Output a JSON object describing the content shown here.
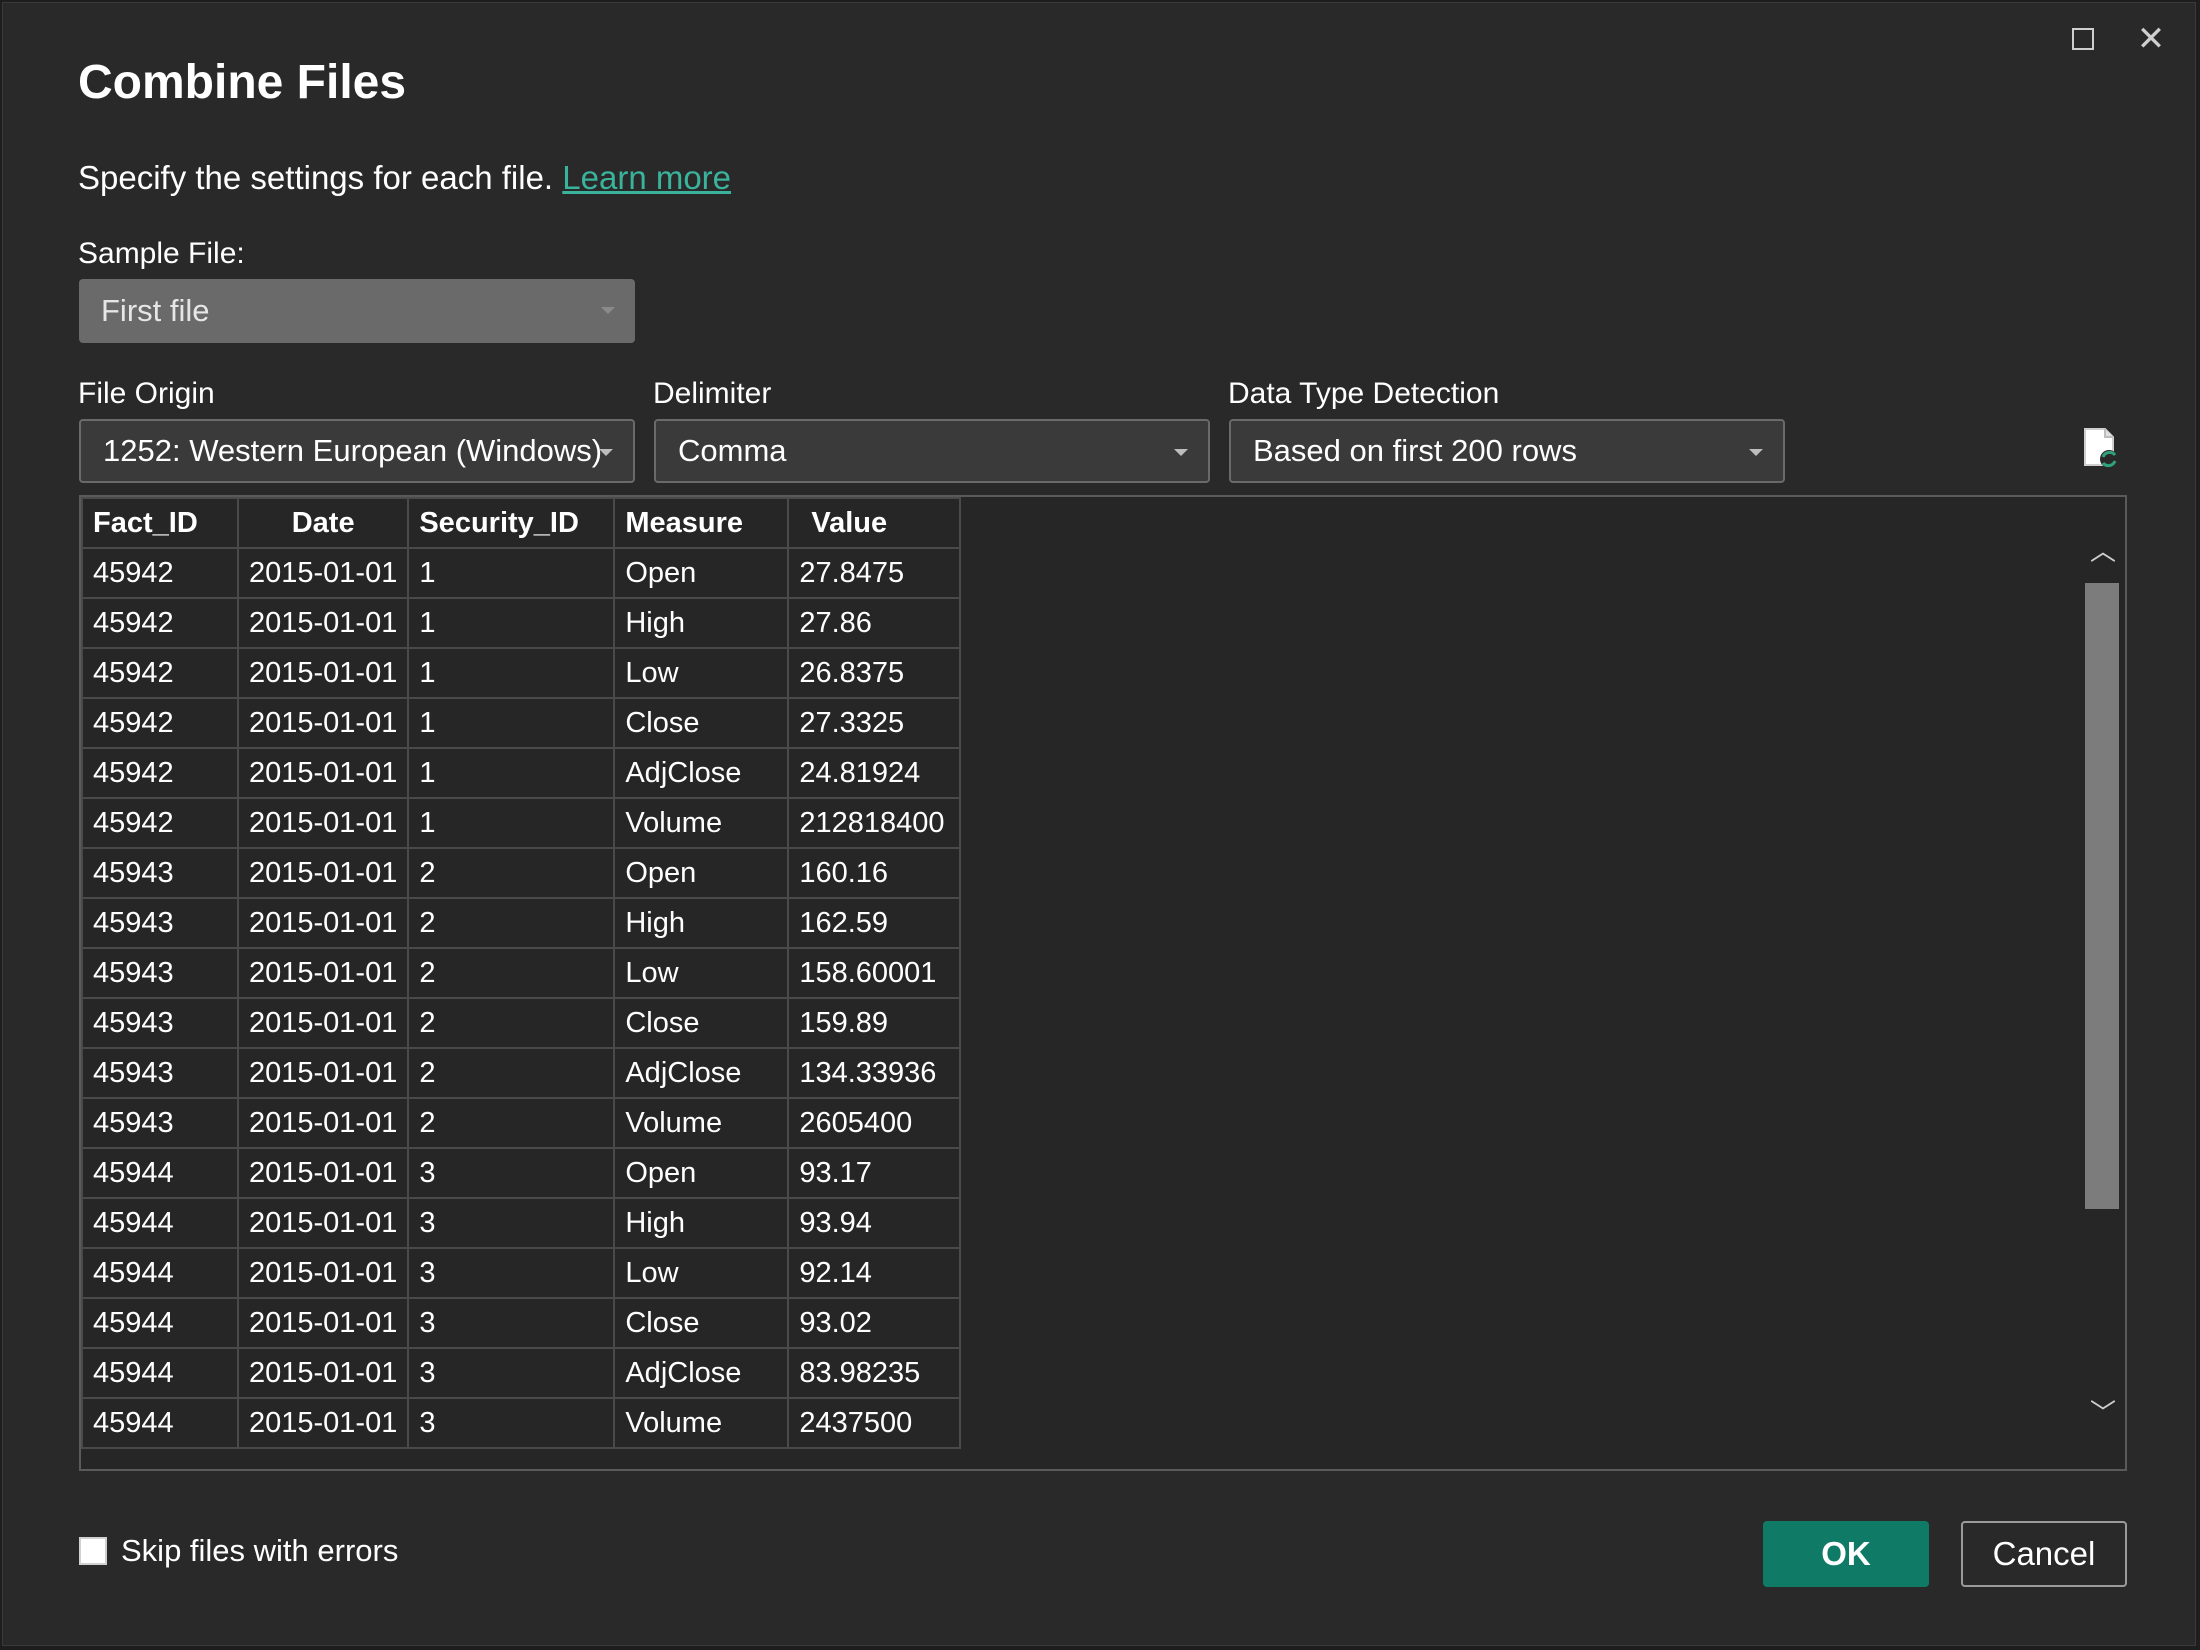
{
  "dialog": {
    "title": "Combine Files",
    "subtitle": "Specify the settings for each file.",
    "learn_more": "Learn more",
    "close_glyph": "✕"
  },
  "sample_file": {
    "label": "Sample File:",
    "value": "First file"
  },
  "file_origin": {
    "label": "File Origin",
    "value": "1252: Western European (Windows)"
  },
  "delimiter": {
    "label": "Delimiter",
    "value": "Comma"
  },
  "data_type_detection": {
    "label": "Data Type Detection",
    "value": "Based on first 200 rows"
  },
  "table": {
    "columns": [
      "Fact_ID",
      "Date",
      "Security_ID",
      "Measure",
      "Value"
    ],
    "rows": [
      [
        "45942",
        "2015-01-01",
        "1",
        "Open",
        "27.8475"
      ],
      [
        "45942",
        "2015-01-01",
        "1",
        "High",
        "27.86"
      ],
      [
        "45942",
        "2015-01-01",
        "1",
        "Low",
        "26.8375"
      ],
      [
        "45942",
        "2015-01-01",
        "1",
        "Close",
        "27.3325"
      ],
      [
        "45942",
        "2015-01-01",
        "1",
        "AdjClose",
        "24.81924"
      ],
      [
        "45942",
        "2015-01-01",
        "1",
        "Volume",
        "212818400"
      ],
      [
        "45943",
        "2015-01-01",
        "2",
        "Open",
        "160.16"
      ],
      [
        "45943",
        "2015-01-01",
        "2",
        "High",
        "162.59"
      ],
      [
        "45943",
        "2015-01-01",
        "2",
        "Low",
        "158.60001"
      ],
      [
        "45943",
        "2015-01-01",
        "2",
        "Close",
        "159.89"
      ],
      [
        "45943",
        "2015-01-01",
        "2",
        "AdjClose",
        "134.33936"
      ],
      [
        "45943",
        "2015-01-01",
        "2",
        "Volume",
        "2605400"
      ],
      [
        "45944",
        "2015-01-01",
        "3",
        "Open",
        "93.17"
      ],
      [
        "45944",
        "2015-01-01",
        "3",
        "High",
        "93.94"
      ],
      [
        "45944",
        "2015-01-01",
        "3",
        "Low",
        "92.14"
      ],
      [
        "45944",
        "2015-01-01",
        "3",
        "Close",
        "93.02"
      ],
      [
        "45944",
        "2015-01-01",
        "3",
        "AdjClose",
        "83.98235"
      ],
      [
        "45944",
        "2015-01-01",
        "3",
        "Volume",
        "2437500"
      ]
    ]
  },
  "scrollbar": {
    "up_glyph": "︿",
    "down_glyph": "﹀"
  },
  "footer": {
    "skip_errors_label": "Skip files with errors",
    "skip_errors_checked": false,
    "ok_label": "OK",
    "cancel_label": "Cancel"
  },
  "colors": {
    "accent": "#0f7a66",
    "link": "#3ab39c",
    "background": "#292929"
  }
}
